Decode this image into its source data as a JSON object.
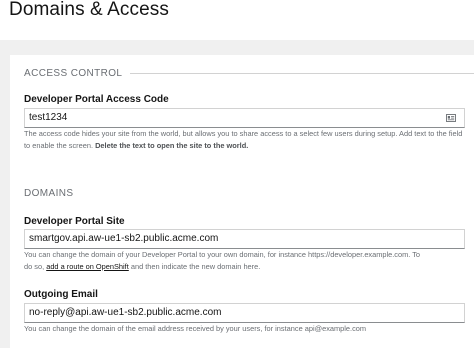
{
  "page": {
    "title": "Domains & Access"
  },
  "access_control": {
    "legend": "ACCESS CONTROL",
    "access_code": {
      "label": "Developer Portal Access Code",
      "value": "test1234",
      "icon": "contact-card-icon",
      "help_text": "The access code hides your site from the world, but allows you to share access to a select few users during setup. Add text to the field to enable the screen.",
      "help_text_bold": "Delete the text to open the site to the world."
    }
  },
  "domains": {
    "legend": "DOMAINS",
    "portal_site": {
      "label": "Developer Portal Site",
      "value": "smartgov.api.aw-ue1-sb2.public.acme.com",
      "help_line1": "You can change the domain of your Developer Portal to your own domain, for instance https://developer.example.com. To",
      "help_prefix": "do so,",
      "help_link": "add a route on OpenShift",
      "help_suffix": "and then indicate the new domain here."
    },
    "outgoing_email": {
      "label": "Outgoing Email",
      "value": "no-reply@api.aw-ue1-sb2.public.acme.com",
      "help_text": "You can change the domain of the email address received by your users, for instance api@example.com"
    }
  }
}
